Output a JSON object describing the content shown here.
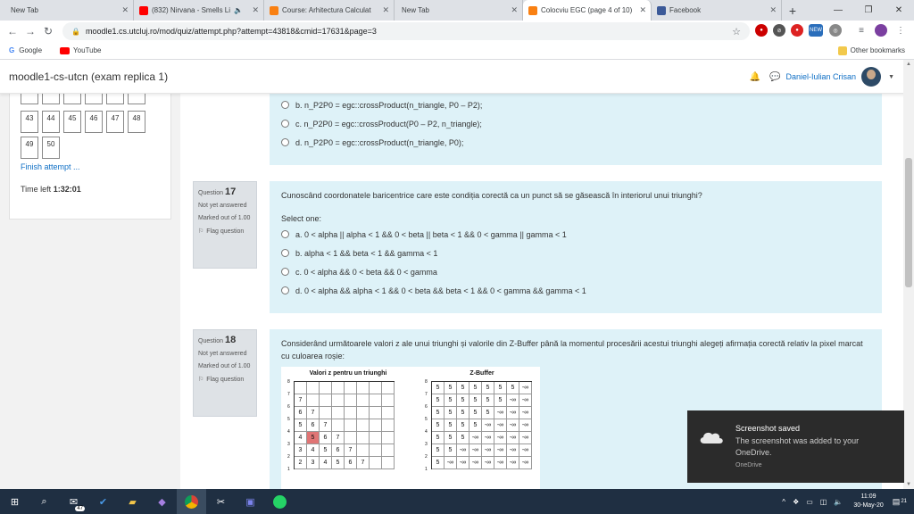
{
  "browser": {
    "tabs": [
      {
        "title": "New Tab",
        "icon": "none",
        "active": false
      },
      {
        "title": "(832) Nirvana - Smells Li",
        "icon": "youtube-icon",
        "active": false
      },
      {
        "title": "Course: Arhitectura Calculat",
        "icon": "moodle-icon",
        "active": false
      },
      {
        "title": "New Tab",
        "icon": "none",
        "active": false
      },
      {
        "title": "Colocviu EGC (page 4 of 10)",
        "icon": "moodle-icon",
        "active": true
      },
      {
        "title": "Facebook",
        "icon": "facebook-icon",
        "active": false
      }
    ],
    "new_tab": "+",
    "url": "moodle1.cs.utcluj.ro/mod/quiz/attempt.php?attempt=43818&cmid=17631&page=3",
    "bookmarks": [
      "Google",
      "YouTube"
    ],
    "other_bookmarks": "Other bookmarks",
    "ext_badge": "NEW"
  },
  "moodle": {
    "site_name": "moodle1-cs-utcn (exam replica 1)",
    "user_name": "Daniel-Iulian Crisan"
  },
  "nav": {
    "row1": [
      "43",
      "44",
      "45",
      "46",
      "47",
      "48"
    ],
    "row2": [
      "49",
      "50"
    ],
    "finish": "Finish attempt ...",
    "time_label": "Time left",
    "time_value": "1:32:01"
  },
  "q16": {
    "options": [
      "b. n_P2P0 = egc::crossProduct(n_triangle, P0 – P2);",
      "c. n_P2P0 = egc::crossProduct(P0 – P2, n_triangle);",
      "d. n_P2P0 = egc::crossProduct(n_triangle, P0);"
    ]
  },
  "q17": {
    "label": "Question",
    "number": "17",
    "status": "Not yet answered",
    "marked": "Marked out of 1.00",
    "flag": "Flag question",
    "text": "Cunoscând coordonatele baricentrice care este condiția corectă ca un punct să se găsească în interiorul unui triunghi?",
    "select_one": "Select one:",
    "options": [
      "a. 0 < alpha  || alpha < 1 && 0 < beta || beta < 1 && 0 < gamma || gamma < 1",
      "b. alpha < 1 && beta < 1 && gamma < 1",
      "c. 0 < alpha  && 0 < beta && 0 < gamma",
      "d. 0 < alpha  && alpha < 1 && 0 < beta && beta < 1 && 0 < gamma && gamma < 1"
    ]
  },
  "q18": {
    "label": "Question",
    "number": "18",
    "status": "Not yet answered",
    "marked": "Marked out of 1.00",
    "flag": "Flag question",
    "text": "Considerând următoarele valori z ale unui triunghi și valorile din Z-Buffer până la momentul procesării acestui triunghi alegeți afirmația corectă relativ la pixel marcat cu culoarea roșie:",
    "grid1_title": "Valori z pentru un triunghi",
    "grid1_rows": [
      [
        "",
        "",
        "",
        "",
        "",
        "",
        "",
        ""
      ],
      [
        "7",
        "",
        "",
        "",
        "",
        "",
        "",
        ""
      ],
      [
        "6",
        "7",
        "",
        "",
        "",
        "",
        "",
        ""
      ],
      [
        "5",
        "6",
        "7",
        "",
        "",
        "",
        "",
        ""
      ],
      [
        "4",
        "5",
        "6",
        "7",
        "",
        "",
        "",
        ""
      ],
      [
        "3",
        "4",
        "5",
        "6",
        "7",
        "",
        "",
        ""
      ],
      [
        "2",
        "3",
        "4",
        "5",
        "6",
        "7",
        "",
        ""
      ]
    ],
    "grid1_red": [
      4,
      1
    ],
    "grid2_title": "Z-Buffer",
    "grid2_rows": [
      [
        "5",
        "5",
        "5",
        "5",
        "5",
        "5",
        "5",
        "-∞"
      ],
      [
        "5",
        "5",
        "5",
        "5",
        "5",
        "5",
        "-∞",
        "-∞"
      ],
      [
        "5",
        "5",
        "5",
        "5",
        "5",
        "-∞",
        "-∞",
        "-∞"
      ],
      [
        "5",
        "5",
        "5",
        "5",
        "-∞",
        "-∞",
        "-∞",
        "-∞"
      ],
      [
        "5",
        "5",
        "5",
        "-∞",
        "-∞",
        "-∞",
        "-∞",
        "-∞"
      ],
      [
        "5",
        "5",
        "-∞",
        "-∞",
        "-∞",
        "-∞",
        "-∞",
        "-∞"
      ],
      [
        "5",
        "-∞",
        "-∞",
        "-∞",
        "-∞",
        "-∞",
        "-∞",
        "-∞"
      ]
    ],
    "y_labels": [
      "8",
      "7",
      "6",
      "5",
      "4",
      "3",
      "2",
      "1"
    ]
  },
  "toast": {
    "title": "Screenshot saved",
    "body": "The screenshot was added to your OneDrive.",
    "source": "OneDrive"
  },
  "taskbar": {
    "mail_badge": "47",
    "time": "11:09",
    "date": "30-May-20",
    "notif_count": "21"
  }
}
